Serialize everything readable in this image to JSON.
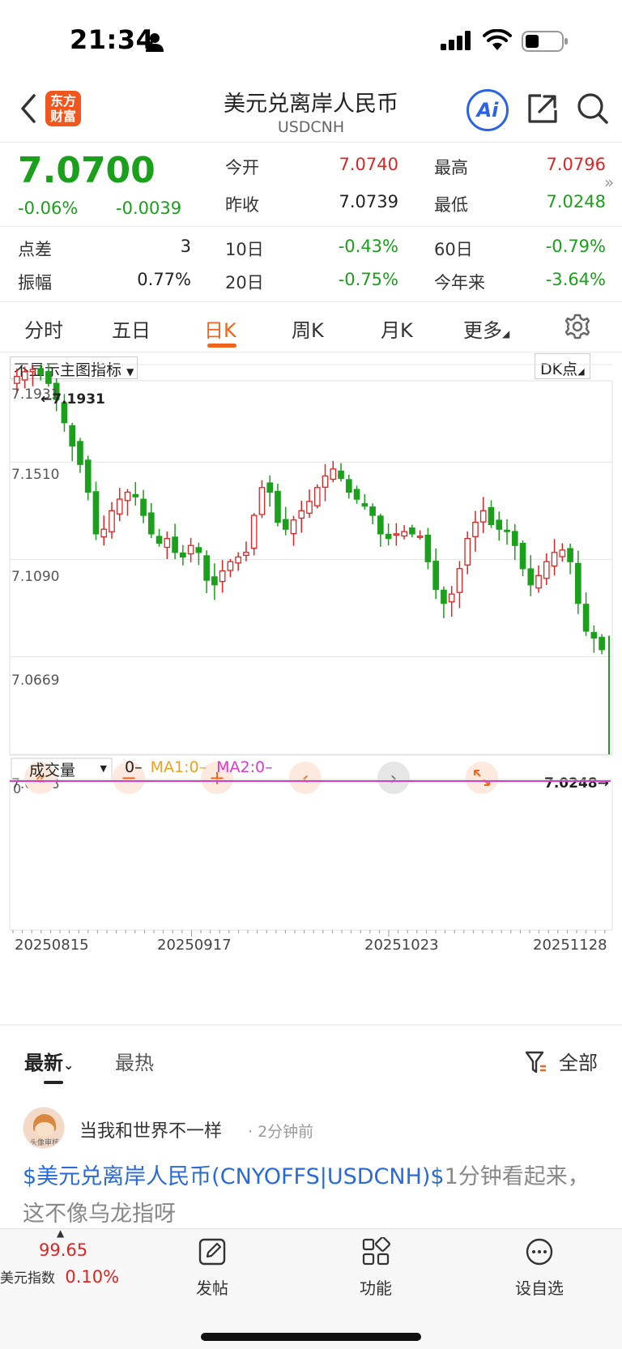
{
  "status": {
    "time": "21:34"
  },
  "nav": {
    "title": "美元兑离岸人民币",
    "subtitle": "USDCNH",
    "logo_text_1": "东方",
    "logo_text_2": "财富",
    "ai_label": "Ai"
  },
  "quote": {
    "price": "7.0700",
    "change_pct": "-0.06%",
    "change": "-0.0039",
    "open_label": "今开",
    "open": "7.0740",
    "high_label": "最高",
    "high": "7.0796",
    "prev_close_label": "昨收",
    "prev_close": "7.0739",
    "low_label": "最低",
    "low": "7.0248",
    "spread_label": "点差",
    "spread": "3",
    "d10_label": "10日",
    "d10": "-0.43%",
    "d60_label": "60日",
    "d60": "-0.79%",
    "amp_label": "振幅",
    "amp": "0.77%",
    "d20_label": "20日",
    "d20": "-0.75%",
    "ytd_label": "今年来",
    "ytd": "-3.64%",
    "colors": {
      "up": "#e02424",
      "down": "#1aa01a"
    }
  },
  "tabs": [
    {
      "label": "分时"
    },
    {
      "label": "五日"
    },
    {
      "label": "日K"
    },
    {
      "label": "周K"
    },
    {
      "label": "月K"
    },
    {
      "label": "更多"
    }
  ],
  "chart": {
    "indicator_label": "不显示主图指标",
    "dk_label": "DK点",
    "price_axis": [
      "7.1931",
      "7.1510",
      "7.1090",
      "7.0669",
      "7.0248"
    ],
    "max_marker": "7.1931",
    "min_marker": "7.0248",
    "volume_label": "成交量",
    "volume_legend_zero": "0–",
    "ma1_legend": "MA1:0–",
    "ma2_legend": "MA2:0–",
    "volume_zero": "0",
    "dates": [
      "20250815",
      "20250917",
      "20251023",
      "20251128"
    ]
  },
  "chart_data": {
    "type": "candlestick",
    "title": "",
    "ylim": [
      7.0248,
      7.1931
    ],
    "y_ticks": [
      7.1931,
      7.151,
      7.109,
      7.0669,
      7.0248
    ],
    "x_ticks": [
      "20250815",
      "20250917",
      "20251023",
      "20251128"
    ],
    "grid": true,
    "closes": [
      7.188,
      7.19,
      7.191,
      7.189,
      7.185,
      7.178,
      7.168,
      7.158,
      7.15,
      7.138,
      7.12,
      7.122,
      7.13,
      7.135,
      7.138,
      7.136,
      7.128,
      7.12,
      7.116,
      7.118,
      7.112,
      7.11,
      7.115,
      7.112,
      7.1,
      7.098,
      7.104,
      7.108,
      7.11,
      7.112,
      7.128,
      7.14,
      7.138,
      7.125,
      7.122,
      7.126,
      7.13,
      7.134,
      7.14,
      7.145,
      7.148,
      7.144,
      7.138,
      7.135,
      7.132,
      7.128,
      7.12,
      7.118,
      7.12,
      7.121,
      7.12,
      7.119,
      7.108,
      7.096,
      7.09,
      7.094,
      7.105,
      7.118,
      7.125,
      7.13,
      7.124,
      7.122,
      7.121,
      7.115,
      7.105,
      7.098,
      7.102,
      7.108,
      7.112,
      7.113,
      7.108,
      7.09,
      7.078,
      7.075,
      7.07
    ]
  },
  "feed": {
    "tab_latest": "最新",
    "tab_hot": "最热",
    "filter_label": "全部",
    "author": "当我和世界不一样",
    "time": "· 2分钟前",
    "avatar_text": "头像审核",
    "post_link": "$美元兑离岸人民币(CNYOFFS|USDCNH)$",
    "post_body": "1分钟看起来，这不像乌龙指呀"
  },
  "tabbar": {
    "index_value": "99.65",
    "index_label": "美元指数",
    "index_change": "0.10%",
    "post_label": "发帖",
    "func_label": "功能",
    "watch_label": "设自选"
  }
}
